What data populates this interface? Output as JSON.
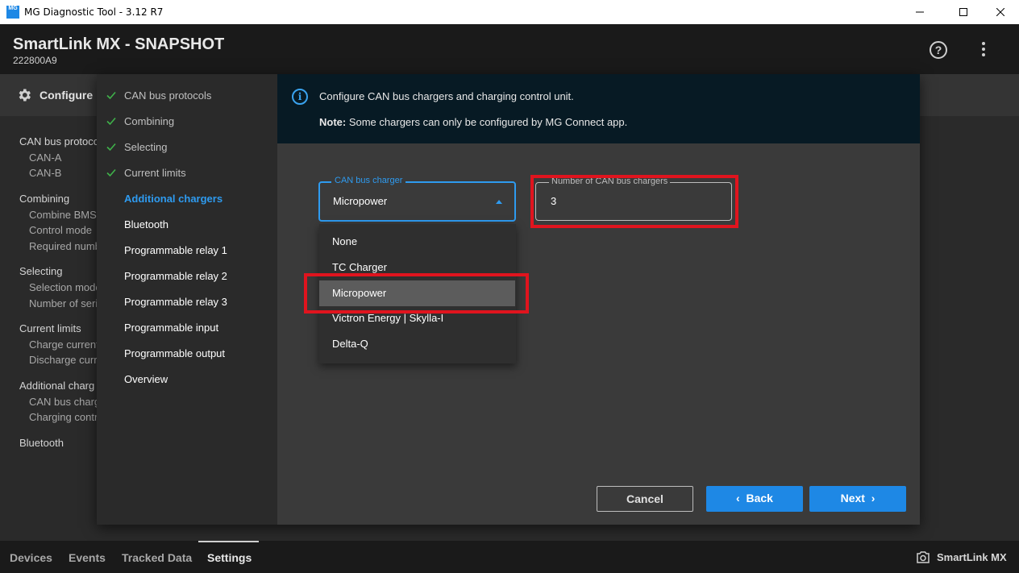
{
  "window": {
    "app_icon_text": "MG",
    "title": "MG Diagnostic Tool - 3.12 R7"
  },
  "header": {
    "title": "SmartLink MX - SNAPSHOT",
    "serial": "222800A9",
    "help_glyph": "?"
  },
  "configbar": {
    "label": "Configure"
  },
  "background_list": [
    {
      "group": "CAN bus protoco",
      "items": [
        "CAN-A",
        "CAN-B"
      ]
    },
    {
      "group": "Combining",
      "items": [
        "Combine BMSs",
        "Control mode",
        "Required numb"
      ]
    },
    {
      "group": "Selecting",
      "items": [
        "Selection mode",
        "Number of seri"
      ]
    },
    {
      "group": "Current limits",
      "items": [
        "Charge current",
        "Discharge curr"
      ]
    },
    {
      "group": "Additional charg",
      "items": [
        "CAN bus charg",
        "Charging contr"
      ]
    },
    {
      "group": "Bluetooth",
      "items": []
    }
  ],
  "steps": [
    {
      "label": "CAN bus protocols",
      "state": "done"
    },
    {
      "label": "Combining",
      "state": "done"
    },
    {
      "label": "Selecting",
      "state": "done"
    },
    {
      "label": "Current limits",
      "state": "done"
    },
    {
      "label": "Additional chargers",
      "state": "active"
    },
    {
      "label": "Bluetooth",
      "state": "pending"
    },
    {
      "label": "Programmable relay 1",
      "state": "pending"
    },
    {
      "label": "Programmable relay 2",
      "state": "pending"
    },
    {
      "label": "Programmable relay 3",
      "state": "pending"
    },
    {
      "label": "Programmable input",
      "state": "pending"
    },
    {
      "label": "Programmable output",
      "state": "pending"
    },
    {
      "label": "Overview",
      "state": "pending"
    }
  ],
  "info": {
    "icon_glyph": "i",
    "line1": "Configure CAN bus chargers and charging control unit.",
    "note_label": "Note:",
    "note_text": " Some chargers can only be configured by MG Connect app."
  },
  "charger_select": {
    "label": "CAN bus charger",
    "value": "Micropower",
    "options": [
      "None",
      "TC Charger",
      "Micropower",
      "Victron Energy | Skylla-I",
      "Delta-Q"
    ],
    "selected_index": 2
  },
  "charger_count": {
    "label": "Number of CAN bus chargers",
    "value": "3"
  },
  "buttons": {
    "cancel": "Cancel",
    "back": "Back",
    "next": "Next",
    "back_glyph": "‹",
    "next_glyph": "›"
  },
  "footer": {
    "tabs": [
      "Devices",
      "Events",
      "Tracked Data",
      "Settings"
    ],
    "active_tab": "Settings",
    "device": "SmartLink MX"
  },
  "colors": {
    "accent": "#1e88e5",
    "active_step": "#2e9bf0",
    "check": "#3fb24a",
    "highlight": "#e0141e",
    "info_bg": "#071a24"
  }
}
